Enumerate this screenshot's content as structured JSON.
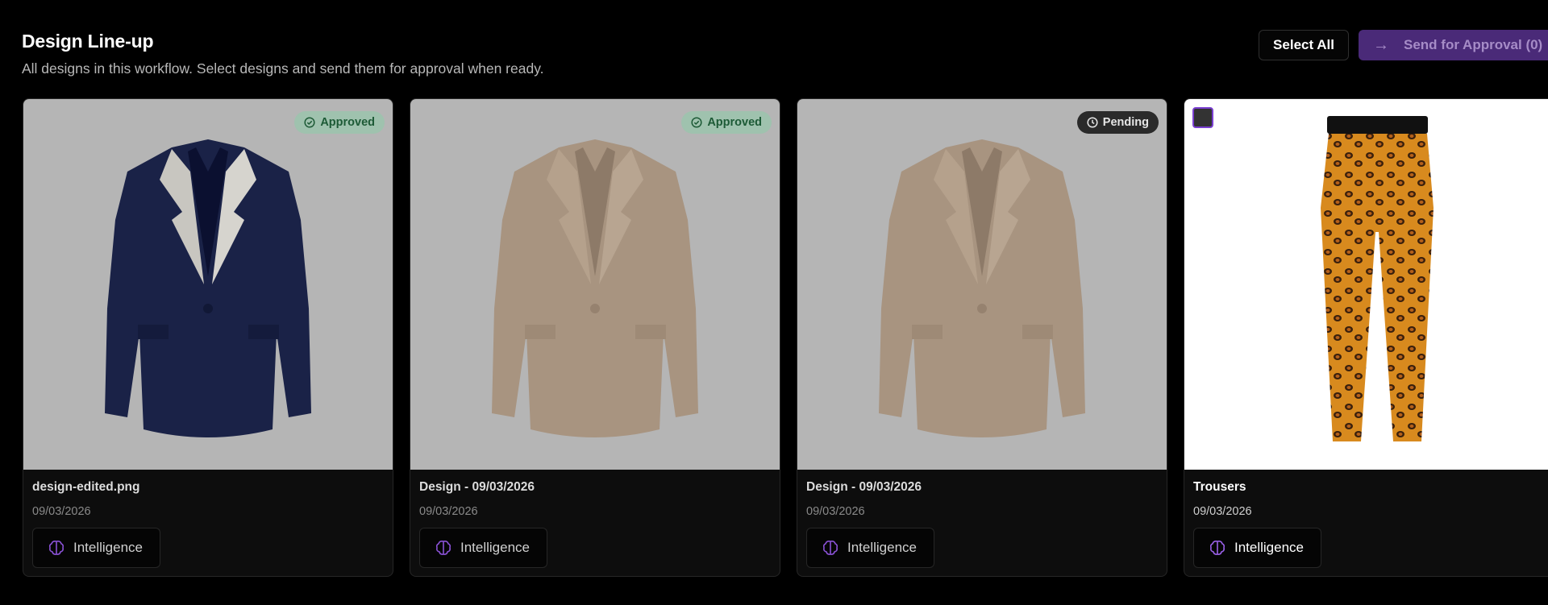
{
  "page": {
    "title": "Design Line-up",
    "subtitle": "All designs in this workflow. Select designs and send them for approval when ready."
  },
  "actions": {
    "select_all": "Select All",
    "send_for_approval": "Send for Approval (0)"
  },
  "colors": {
    "accent": "#6b3fa0",
    "approved_bg": "#9fc2ae",
    "approved_text": "#1d5a36",
    "pending_bg": "#2a2a2a"
  },
  "designs": [
    {
      "name": "design-edited.png",
      "date": "09/03/2026",
      "status": "Approved",
      "tag": "Intelligence",
      "garment": "navy blazer with satin lapels"
    },
    {
      "name": "Design - 09/03/2026",
      "date": "09/03/2026",
      "status": "Approved",
      "tag": "Intelligence",
      "garment": "beige blazer"
    },
    {
      "name": "Design - 09/03/2026",
      "date": "09/03/2026",
      "status": "Pending",
      "tag": "Intelligence",
      "garment": "beige blazer"
    },
    {
      "name": "Trousers",
      "date": "09/03/2026",
      "status": "",
      "tag": "Intelligence",
      "garment": "leopard print trousers"
    }
  ],
  "icons": {
    "approved": "check-circle-icon",
    "pending": "clock-icon",
    "tag": "brain-icon",
    "send": "arrow-right-icon"
  }
}
